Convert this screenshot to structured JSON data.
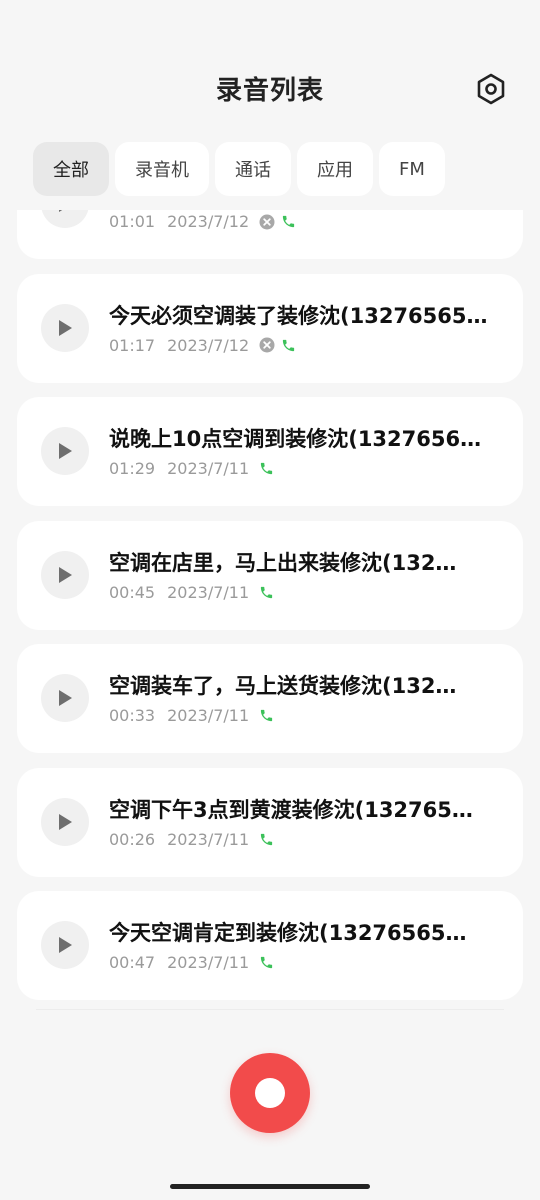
{
  "header": {
    "title": "录音列表",
    "settings_icon": "settings-hexagon-icon"
  },
  "tabs": [
    {
      "label": "全部",
      "active": true
    },
    {
      "label": "录音机",
      "active": false
    },
    {
      "label": "通话",
      "active": false
    },
    {
      "label": "应用",
      "active": false
    },
    {
      "label": "FM",
      "active": false
    }
  ],
  "recordings": [
    {
      "title": "",
      "duration": "01:01",
      "date": "2023/7/12",
      "failed": true,
      "type": "call"
    },
    {
      "title": "今天必须空调装了装修沈(13276565…",
      "duration": "01:17",
      "date": "2023/7/12",
      "failed": true,
      "type": "call"
    },
    {
      "title": "说晚上10点空调到装修沈(1327656…",
      "duration": "01:29",
      "date": "2023/7/11",
      "failed": false,
      "type": "call"
    },
    {
      "title": "空调在店里，马上出来装修沈(132…",
      "duration": "00:45",
      "date": "2023/7/11",
      "failed": false,
      "type": "call"
    },
    {
      "title": "空调装车了，马上送货装修沈(132…",
      "duration": "00:33",
      "date": "2023/7/11",
      "failed": false,
      "type": "call"
    },
    {
      "title": "空调下午3点到黄渡装修沈(132765…",
      "duration": "00:26",
      "date": "2023/7/11",
      "failed": false,
      "type": "call"
    },
    {
      "title": "今天空调肯定到装修沈(13276565…",
      "duration": "00:47",
      "date": "2023/7/11",
      "failed": false,
      "type": "call"
    }
  ],
  "colors": {
    "background": "#f6f6f6",
    "card": "#ffffff",
    "record_button": "#f24b4b",
    "call_icon": "#3cc15a",
    "meta_text": "#9a9a9a"
  },
  "record_button_icon": "record-icon"
}
